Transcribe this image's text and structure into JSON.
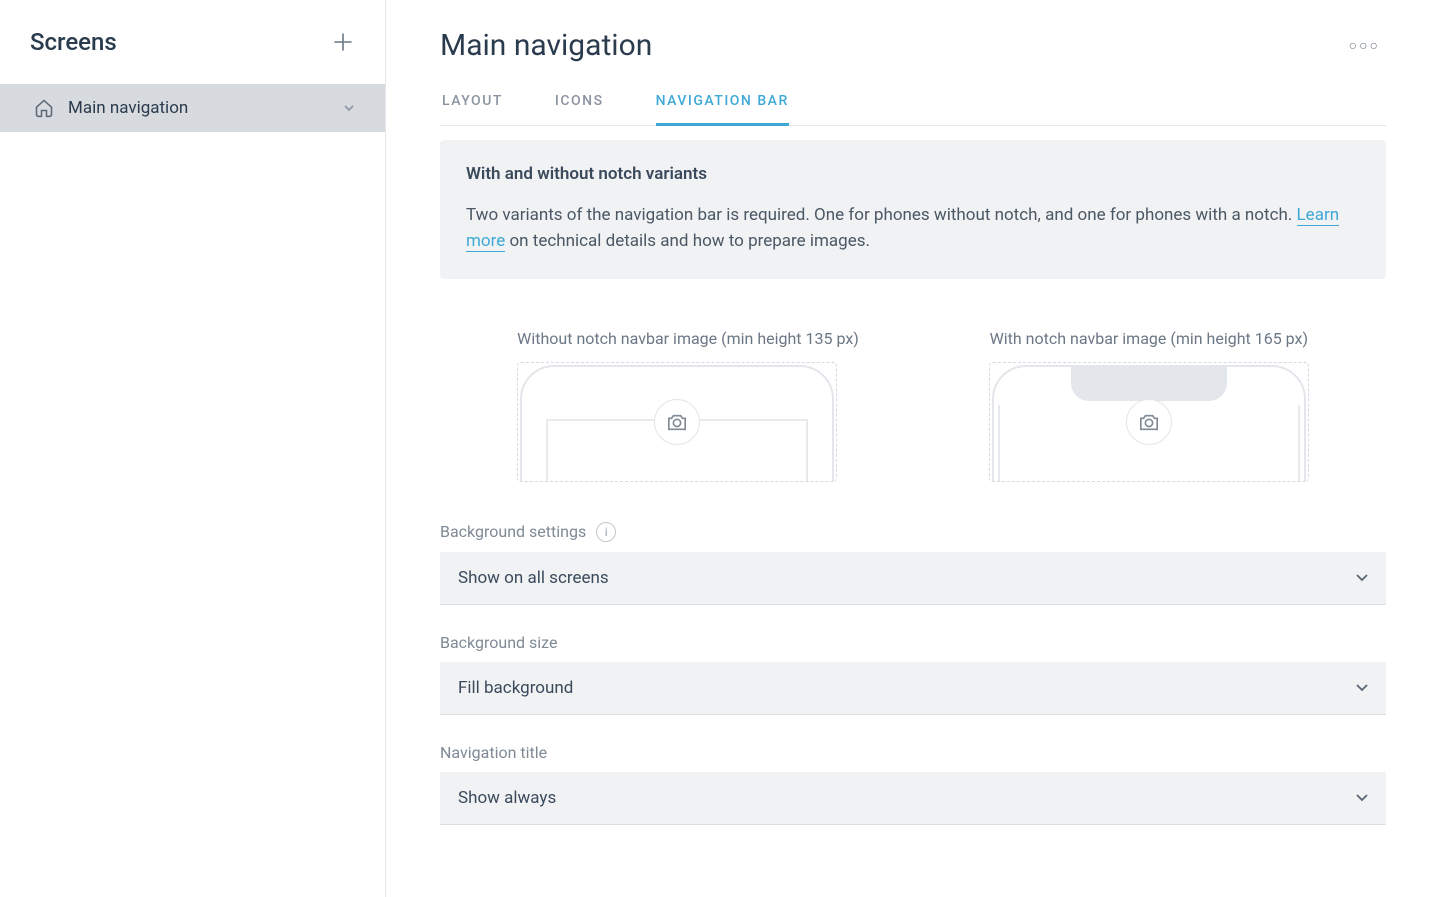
{
  "sidebar": {
    "title": "Screens",
    "items": [
      {
        "label": "Main navigation"
      }
    ]
  },
  "header": {
    "title": "Main navigation"
  },
  "tabs": [
    {
      "label": "Layout",
      "active": false
    },
    {
      "label": "Icons",
      "active": false
    },
    {
      "label": "Navigation Bar",
      "active": true
    }
  ],
  "info": {
    "title": "With and without notch variants",
    "body_1": "Two variants of the navigation bar is required. One for phones without notch, and one for phones with a notch. ",
    "link": "Learn more",
    "body_2": " on technical details and how to prepare images."
  },
  "uploads": {
    "without_notch_label": "Without notch navbar image (min height 135 px)",
    "with_notch_label": "With notch navbar image (min height 165 px)"
  },
  "fields": {
    "background_settings": {
      "label": "Background settings",
      "value": "Show on all screens"
    },
    "background_size": {
      "label": "Background size",
      "value": "Fill background"
    },
    "navigation_title": {
      "label": "Navigation title",
      "value": "Show always"
    }
  }
}
